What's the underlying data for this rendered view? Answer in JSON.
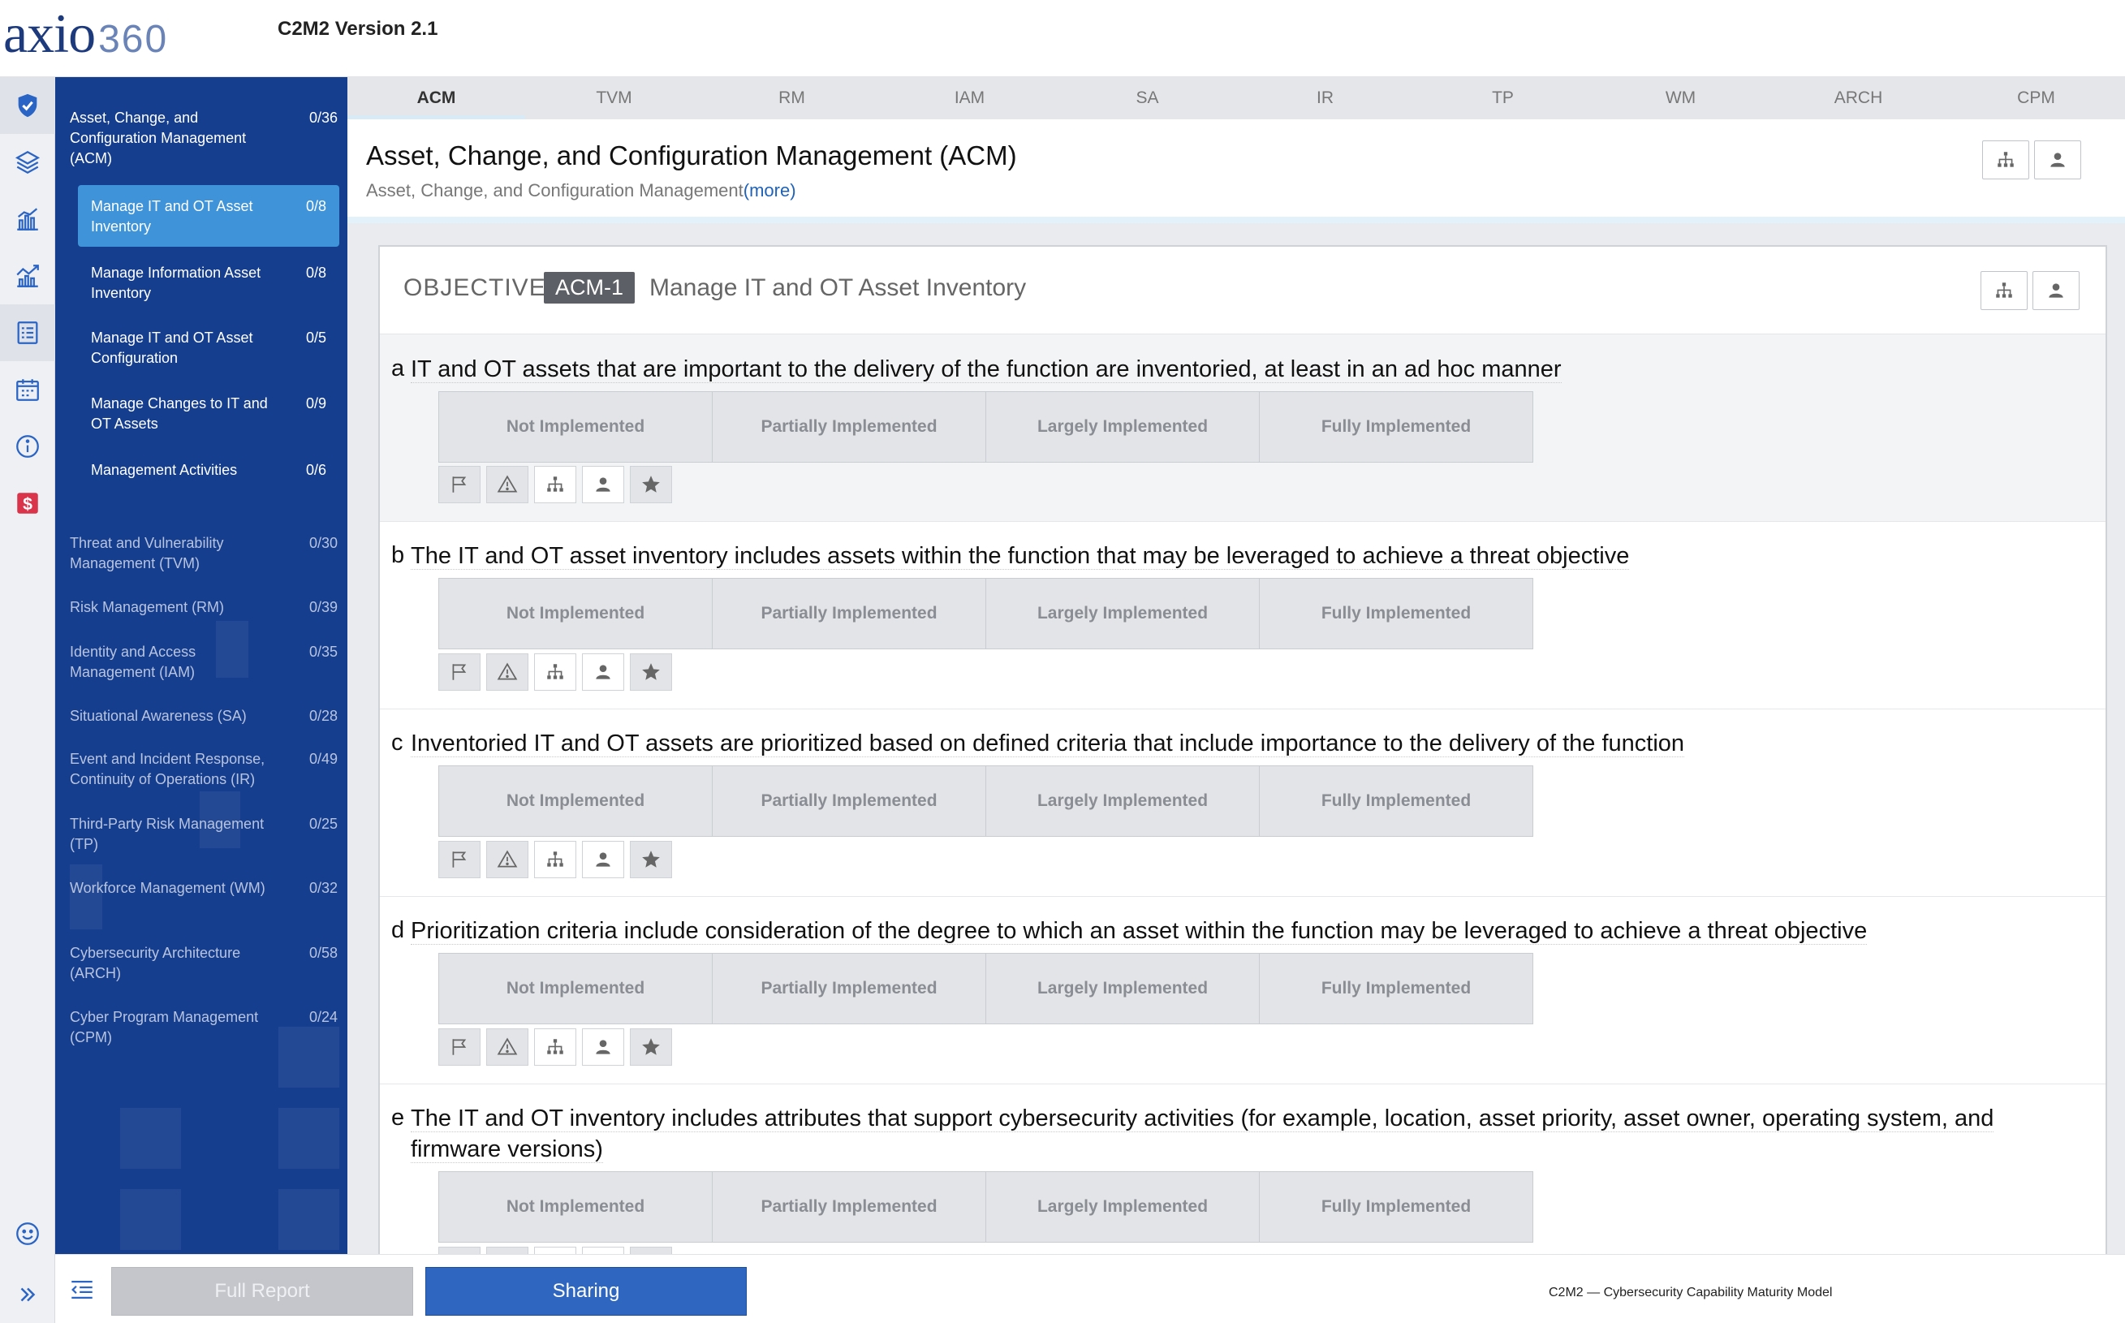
{
  "header": {
    "logo_brand": "axio",
    "logo_number": "360",
    "title": "C2M2 Version 2.1"
  },
  "rail": {
    "icons": [
      "shield-check-icon",
      "layers-icon",
      "bar-chart-icon",
      "trend-chart-icon",
      "list-icon",
      "calendar-icon",
      "info-icon",
      "dollar-icon"
    ],
    "bottom_icons": [
      "smiley-icon",
      "double-chevron-right-icon"
    ]
  },
  "sidebar": {
    "current_domain": {
      "label": "Asset, Change, and Configuration Management (ACM)",
      "count": "0/36"
    },
    "subitems": [
      {
        "label": "Manage IT and OT Asset Inventory",
        "count": "0/8",
        "active": true
      },
      {
        "label": "Manage Information Asset Inventory",
        "count": "0/8"
      },
      {
        "label": "Manage IT and OT Asset Configuration",
        "count": "0/5"
      },
      {
        "label": "Manage Changes to IT and OT Assets",
        "count": "0/9"
      },
      {
        "label": "Management Activities",
        "count": "0/6"
      }
    ],
    "domains": [
      {
        "label": "Threat and Vulnerability Management (TVM)",
        "count": "0/30"
      },
      {
        "label": "Risk Management (RM)",
        "count": "0/39"
      },
      {
        "label": "Identity and Access Management (IAM)",
        "count": "0/35"
      },
      {
        "label": "Situational Awareness (SA)",
        "count": "0/28"
      },
      {
        "label": "Event and Incident Response, Continuity of Operations (IR)",
        "count": "0/49"
      },
      {
        "label": "Third-Party Risk Management (TP)",
        "count": "0/25"
      },
      {
        "label": "Workforce Management (WM)",
        "count": "0/32"
      },
      {
        "label": "Cybersecurity Architecture (ARCH)",
        "count": "0/58"
      },
      {
        "label": "Cyber Program Management (CPM)",
        "count": "0/24"
      }
    ]
  },
  "tabs": [
    "ACM",
    "TVM",
    "RM",
    "IAM",
    "SA",
    "IR",
    "TP",
    "WM",
    "ARCH",
    "CPM"
  ],
  "active_tab": "ACM",
  "section": {
    "title": "Asset, Change, and Configuration Management (ACM)",
    "subtitle": "Asset, Change, and Configuration Management",
    "more_link": "(more)"
  },
  "objective": {
    "label": "OBJECTIVE",
    "code": "ACM-1",
    "name": "Manage IT and OT Asset Inventory"
  },
  "levels": [
    "Not Implemented",
    "Partially Implemented",
    "Largely Implemented",
    "Fully Implemented"
  ],
  "practice_tools": [
    "flag-icon",
    "warning-icon",
    "org-chart-icon",
    "person-icon",
    "star-icon"
  ],
  "practices": [
    {
      "letter": "a",
      "text": "IT and OT assets that are important to the delivery of the function are inventoried, at least in an ad hoc manner"
    },
    {
      "letter": "b",
      "text": "The IT and OT asset inventory includes assets within the function that may be leveraged to achieve a threat objective"
    },
    {
      "letter": "c",
      "text": "Inventoried IT and OT assets are prioritized based on defined criteria that include importance to the delivery of the function"
    },
    {
      "letter": "d",
      "text": "Prioritization criteria include consideration of the degree to which an asset within the function may be leveraged to achieve a threat objective"
    },
    {
      "letter": "e",
      "text": "The IT and OT inventory includes attributes that support cybersecurity activities (for example, location, asset priority, asset owner, operating system, and firmware versions)"
    }
  ],
  "footer": {
    "full_report": "Full Report",
    "sharing": "Sharing",
    "note": "C2M2 — Cybersecurity Capability Maturity Model"
  },
  "colors": {
    "sidebar_bg": "#163e8f",
    "active_item": "#3f93d8",
    "share_button": "#2f67c0",
    "logo": "#1d3a7c",
    "dollar_icon": "#d9344a"
  }
}
